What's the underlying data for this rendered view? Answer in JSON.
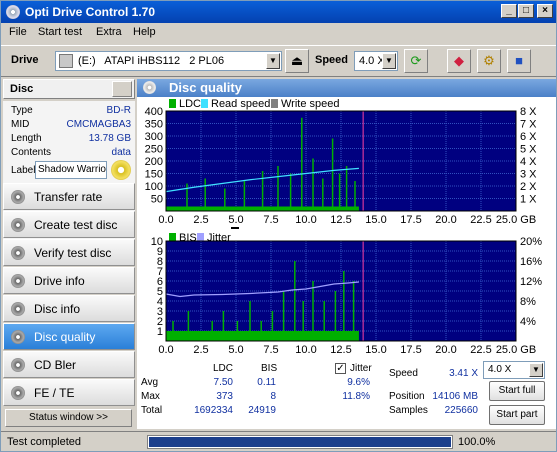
{
  "window": {
    "title": "Opti Drive Control 1.70"
  },
  "menu": [
    "File",
    "Start test",
    "Extra",
    "Help"
  ],
  "drivebar": {
    "drive_label": "Drive",
    "drive_value": "(E:)   ATAPI iHBS112   2 PL06",
    "speed_label": "Speed",
    "speed_value": "4.0 X"
  },
  "disc": {
    "header": "Disc",
    "rows": [
      {
        "key": "Type",
        "value": "BD-R"
      },
      {
        "key": "MID",
        "value": "CMCMAGBA3"
      },
      {
        "key": "Length",
        "value": "13.78 GB"
      },
      {
        "key": "Contents",
        "value": "data"
      }
    ],
    "label_key": "Label",
    "label_value": "Shadow Warrio"
  },
  "nav": [
    "Transfer rate",
    "Create test disc",
    "Verify test disc",
    "Drive info",
    "Disc info",
    "Disc quality",
    "CD Bler",
    "FE / TE"
  ],
  "nav_active": 5,
  "status_window_btn": "Status window >>",
  "panel": {
    "title": "Disc quality"
  },
  "chart_data": [
    {
      "type": "line",
      "legend": [
        "LDC",
        "Read speed",
        "Write speed"
      ],
      "colors": {
        "LDC": "#00b000",
        "Read speed": "#40e0ff",
        "Write speed": "#808080"
      },
      "x_ticks": [
        "0.0",
        "2.5",
        "5.0",
        "7.5",
        "10.0",
        "12.5",
        "15.0",
        "17.5",
        "20.0",
        "22.5",
        "25.0 GB"
      ],
      "y_ticks_left": [
        "50",
        "100",
        "150",
        "200",
        "250",
        "300",
        "350",
        "400"
      ],
      "y_ticks_right": [
        "1 X",
        "2 X",
        "3 X",
        "4 X",
        "5 X",
        "6 X",
        "7 X",
        "8 X"
      ],
      "xlim": [
        0,
        25
      ],
      "ylim": [
        0,
        400
      ],
      "data_end_gb": 13.78,
      "read_speed": {
        "x": [
          0,
          2,
          4,
          6,
          8,
          10,
          12,
          13.78
        ],
        "y": [
          1.55,
          1.9,
          2.2,
          2.5,
          2.75,
          3.0,
          3.25,
          3.41
        ]
      },
      "ldc_spikes": {
        "x": [
          1.5,
          2.8,
          4.2,
          5.6,
          6.9,
          8.0,
          8.9,
          9.7,
          10.5,
          11.2,
          11.9,
          12.4,
          12.9,
          13.5
        ],
        "y": [
          110,
          130,
          90,
          120,
          160,
          180,
          150,
          373,
          210,
          130,
          290,
          150,
          180,
          120
        ]
      }
    },
    {
      "type": "line",
      "legend": [
        "BIS",
        "Jitter"
      ],
      "colors": {
        "BIS": "#00b000",
        "Jitter": "#a0a0ff"
      },
      "x_ticks": [
        "0.0",
        "2.5",
        "5.0",
        "7.5",
        "10.0",
        "12.5",
        "15.0",
        "17.5",
        "20.0",
        "22.5",
        "25.0 GB"
      ],
      "y_ticks_left": [
        "1",
        "2",
        "3",
        "4",
        "5",
        "6",
        "7",
        "8",
        "9",
        "10"
      ],
      "y_ticks_right": [
        "4%",
        "8%",
        "12%",
        "16%",
        "20%"
      ],
      "xlim": [
        0,
        25
      ],
      "ylim": [
        0,
        10
      ],
      "data_end_gb": 13.78,
      "jitter": {
        "x": [
          0,
          1,
          2,
          4,
          6,
          8,
          9,
          10,
          11,
          12,
          13,
          13.78
        ],
        "y": [
          9.4,
          8.9,
          9.2,
          9.3,
          9.5,
          9.8,
          10.2,
          10.4,
          10.9,
          11.4,
          11.6,
          11.8
        ]
      },
      "bis_spikes": {
        "x": [
          0.5,
          1.6,
          2.4,
          3.3,
          4.1,
          5.1,
          6.0,
          6.8,
          7.6,
          8.4,
          9.2,
          9.8,
          10.5,
          11.3,
          12.1,
          12.7,
          13.4
        ],
        "y": [
          2,
          3,
          1,
          2,
          3,
          2,
          4,
          2,
          3,
          5,
          8,
          4,
          6,
          4,
          5,
          7,
          6
        ]
      }
    }
  ],
  "stats": {
    "col_ldc": "LDC",
    "col_bis": "BIS",
    "avg_label": "Avg",
    "avg_ldc": "7.50",
    "avg_bis": "0.11",
    "avg_jitter": "9.6%",
    "max_label": "Max",
    "max_ldc": "373",
    "max_bis": "8",
    "max_jitter": "11.8%",
    "total_label": "Total",
    "total_ldc": "1692334",
    "total_bis": "24919",
    "jitter_label": "Jitter",
    "jitter_checked": true,
    "speed_label": "Speed",
    "speed_value": "3.41 X",
    "speed_select": "4.0 X",
    "position_label": "Position",
    "position_value": "14106 MB",
    "samples_label": "Samples",
    "samples_value": "225660",
    "start_full": "Start full",
    "start_part": "Start part"
  },
  "status": {
    "text": "Test completed",
    "progress": 1.0,
    "progress_label": "100.0%"
  }
}
